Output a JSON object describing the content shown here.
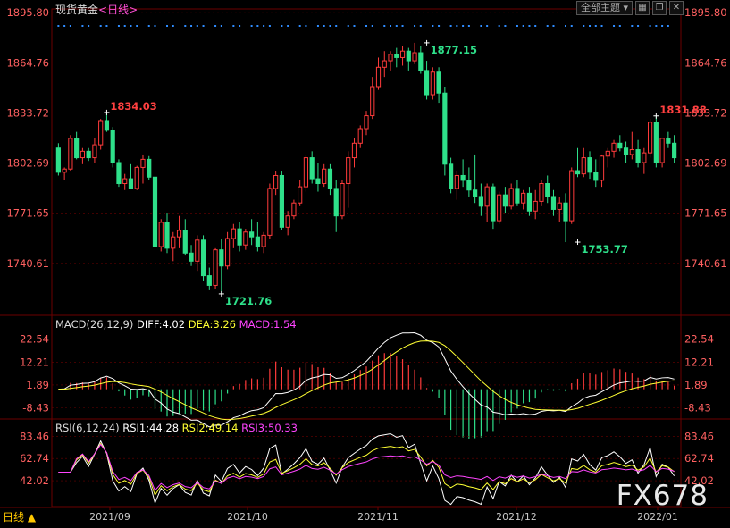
{
  "header": {
    "title": "现货黄金",
    "period_label": "<日线>",
    "theme_button": "全部主题 ▾",
    "icons": [
      "grid-icon",
      "restore-icon",
      "close-icon"
    ]
  },
  "colors": {
    "up": "#ff3b3b",
    "down": "#2ee08a",
    "ma": "#ffffff",
    "dea": "#ffff33",
    "macd_label": "#ff44ff",
    "rsi1": "#ffffff",
    "rsi2": "#ffff33",
    "rsi3": "#ff44ff",
    "grid": "#6b0000",
    "ref_line": "#ff8c1a",
    "dots": "#2f8cff"
  },
  "watermark": "FX678",
  "period_button": "日线 ▲",
  "chart_data": {
    "type": "candlestick",
    "title": "现货黄金",
    "x_labels": [
      "2021/09",
      "2021/10",
      "2021/11",
      "2021/12",
      "2022/01"
    ],
    "price_axis": {
      "ticks": [
        "1895.80",
        "1864.76",
        "1833.72",
        "1802.69",
        "1771.65",
        "1740.61"
      ],
      "ylim": [
        1709,
        1897
      ]
    },
    "reference_price": 1802.69,
    "annotations": [
      {
        "label": "1834.03",
        "price": 1834.03,
        "index": 8
      },
      {
        "label": "1721.76",
        "price": 1721.76,
        "index": 27
      },
      {
        "label": "1877.15",
        "price": 1877.15,
        "index": 61
      },
      {
        "label": "1753.77",
        "price": 1753.77,
        "index": 86
      },
      {
        "label": "1831.88",
        "price": 1831.88,
        "index": 99
      }
    ],
    "ohlc": [
      [
        1812,
        1815,
        1795,
        1797
      ],
      [
        1797,
        1800,
        1792,
        1799
      ],
      [
        1799,
        1820,
        1798,
        1818
      ],
      [
        1818,
        1822,
        1805,
        1806
      ],
      [
        1806,
        1812,
        1802,
        1810
      ],
      [
        1810,
        1812,
        1804,
        1806
      ],
      [
        1806,
        1818,
        1803,
        1814
      ],
      [
        1814,
        1830,
        1811,
        1829
      ],
      [
        1829,
        1834.03,
        1822,
        1823
      ],
      [
        1823,
        1825,
        1800,
        1803
      ],
      [
        1803,
        1805,
        1788,
        1790
      ],
      [
        1790,
        1796,
        1786,
        1793
      ],
      [
        1793,
        1802,
        1789,
        1787
      ],
      [
        1787,
        1801,
        1786,
        1800
      ],
      [
        1800,
        1808,
        1790,
        1805
      ],
      [
        1805,
        1807,
        1792,
        1794
      ],
      [
        1794,
        1796,
        1748,
        1751
      ],
      [
        1751,
        1768,
        1748,
        1766
      ],
      [
        1766,
        1772,
        1747,
        1750
      ],
      [
        1750,
        1760,
        1742,
        1757
      ],
      [
        1757,
        1770,
        1750,
        1761
      ],
      [
        1761,
        1768,
        1746,
        1747
      ],
      [
        1747,
        1752,
        1739,
        1742
      ],
      [
        1742,
        1758,
        1736,
        1755
      ],
      [
        1755,
        1758,
        1730,
        1733
      ],
      [
        1733,
        1738,
        1724,
        1727
      ],
      [
        1727,
        1750,
        1725,
        1749
      ],
      [
        1749,
        1756,
        1721.76,
        1739
      ],
      [
        1739,
        1760,
        1737,
        1756
      ],
      [
        1756,
        1765,
        1750,
        1762
      ],
      [
        1762,
        1766,
        1748,
        1752
      ],
      [
        1752,
        1762,
        1749,
        1760
      ],
      [
        1760,
        1768,
        1752,
        1757
      ],
      [
        1757,
        1766,
        1748,
        1751
      ],
      [
        1751,
        1760,
        1747,
        1758
      ],
      [
        1758,
        1790,
        1756,
        1787
      ],
      [
        1787,
        1798,
        1783,
        1795
      ],
      [
        1795,
        1798,
        1761,
        1763
      ],
      [
        1763,
        1773,
        1758,
        1770
      ],
      [
        1770,
        1780,
        1768,
        1778
      ],
      [
        1778,
        1792,
        1776,
        1788
      ],
      [
        1788,
        1808,
        1785,
        1806
      ],
      [
        1806,
        1810,
        1790,
        1793
      ],
      [
        1793,
        1803,
        1785,
        1790
      ],
      [
        1790,
        1802,
        1788,
        1799
      ],
      [
        1799,
        1802,
        1783,
        1787
      ],
      [
        1787,
        1792,
        1760,
        1770
      ],
      [
        1770,
        1792,
        1768,
        1790
      ],
      [
        1790,
        1810,
        1775,
        1806
      ],
      [
        1806,
        1818,
        1800,
        1815
      ],
      [
        1815,
        1826,
        1812,
        1824
      ],
      [
        1824,
        1835,
        1820,
        1832
      ],
      [
        1832,
        1856,
        1830,
        1850
      ],
      [
        1850,
        1868,
        1848,
        1862
      ],
      [
        1862,
        1872,
        1856,
        1866
      ],
      [
        1866,
        1872,
        1860,
        1870
      ],
      [
        1870,
        1874,
        1862,
        1868
      ],
      [
        1868,
        1875,
        1863,
        1872
      ],
      [
        1872,
        1874,
        1860,
        1866
      ],
      [
        1866,
        1877.15,
        1864,
        1871
      ],
      [
        1871,
        1875,
        1858,
        1860
      ],
      [
        1860,
        1866,
        1842,
        1845
      ],
      [
        1845,
        1862,
        1842,
        1859
      ],
      [
        1859,
        1862,
        1840,
        1846
      ],
      [
        1846,
        1850,
        1795,
        1802
      ],
      [
        1802,
        1806,
        1784,
        1787
      ],
      [
        1787,
        1798,
        1780,
        1795
      ],
      [
        1795,
        1805,
        1788,
        1792
      ],
      [
        1792,
        1800,
        1782,
        1786
      ],
      [
        1786,
        1808,
        1778,
        1782
      ],
      [
        1782,
        1790,
        1770,
        1776
      ],
      [
        1776,
        1790,
        1766,
        1788
      ],
      [
        1788,
        1790,
        1762,
        1767
      ],
      [
        1767,
        1785,
        1765,
        1783
      ],
      [
        1783,
        1788,
        1772,
        1776
      ],
      [
        1776,
        1790,
        1774,
        1787
      ],
      [
        1787,
        1792,
        1776,
        1778
      ],
      [
        1778,
        1786,
        1774,
        1784
      ],
      [
        1784,
        1788,
        1770,
        1773
      ],
      [
        1773,
        1786,
        1768,
        1779
      ],
      [
        1779,
        1792,
        1776,
        1790
      ],
      [
        1790,
        1795,
        1778,
        1782
      ],
      [
        1782,
        1786,
        1770,
        1774
      ],
      [
        1774,
        1782,
        1766,
        1778
      ],
      [
        1778,
        1784,
        1753.77,
        1767
      ],
      [
        1767,
        1800,
        1765,
        1798
      ],
      [
        1798,
        1812,
        1794,
        1796
      ],
      [
        1796,
        1812,
        1794,
        1806
      ],
      [
        1806,
        1810,
        1793,
        1797
      ],
      [
        1797,
        1805,
        1788,
        1792
      ],
      [
        1792,
        1808,
        1788,
        1807
      ],
      [
        1807,
        1812,
        1800,
        1810
      ],
      [
        1810,
        1817,
        1806,
        1815
      ],
      [
        1815,
        1820,
        1810,
        1812
      ],
      [
        1812,
        1816,
        1803,
        1808
      ],
      [
        1808,
        1822,
        1805,
        1811
      ],
      [
        1811,
        1817,
        1800,
        1803
      ],
      [
        1803,
        1812,
        1796,
        1809
      ],
      [
        1809,
        1830,
        1806,
        1828
      ],
      [
        1828,
        1831.88,
        1800,
        1803
      ],
      [
        1803,
        1818,
        1800,
        1818
      ],
      [
        1818,
        1822,
        1812,
        1815
      ],
      [
        1815,
        1820,
        1803,
        1806
      ]
    ],
    "macd": {
      "label": "MACD(26,12,9)",
      "diff_label": "DIFF:4.02",
      "dea_label": "DEA:3.26",
      "macd_value_label": "MACD:1.54",
      "ticks": [
        "22.54",
        "12.21",
        "1.89",
        "-8.43"
      ],
      "ylim": [
        -13,
        28
      ]
    },
    "rsi": {
      "label": "RSI(6,12,24)",
      "rsi1_label": "RSI1:44.28",
      "rsi2_label": "RSI2:49.14",
      "rsi3_label": "RSI3:50.33",
      "ticks": [
        "83.46",
        "62.74",
        "42.02"
      ],
      "ylim": [
        18,
        92
      ]
    }
  }
}
